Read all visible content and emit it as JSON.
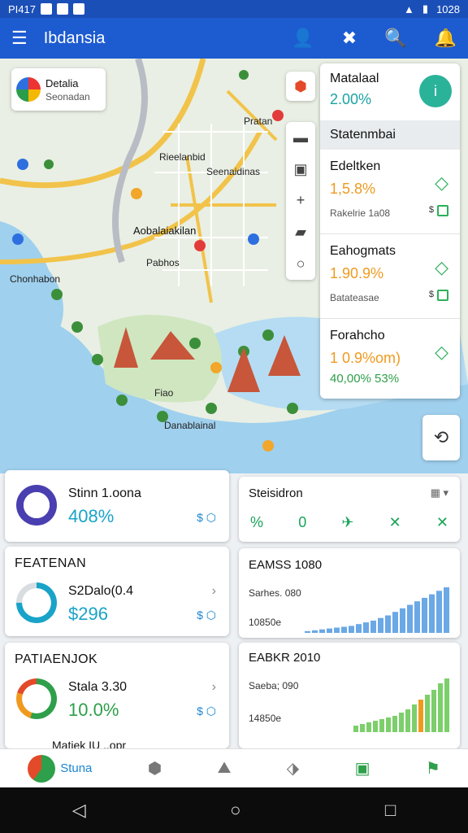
{
  "status_bar": {
    "time": "PI417",
    "right_time": "1028"
  },
  "app_bar": {
    "title": "Ibdansia"
  },
  "map": {
    "place_card": {
      "title": "Detalia",
      "subtitle": "Seonadan"
    },
    "labels": [
      "Pratan",
      "Rieelanbid",
      "Seenaidinas",
      "Aobalaiakilan",
      "Chonhabon",
      "Pabhos",
      "Fiao",
      "Danablainal"
    ]
  },
  "side_panel": {
    "title": "Matalaal",
    "value": "2.00%",
    "section_header": "Statenmbai",
    "items": [
      {
        "name": "Edeltken",
        "pct": "1,5.8%",
        "sub": "Rakelrie 1a08"
      },
      {
        "name": "Eahogmats",
        "pct": "1.90.9%",
        "sub": "Batateasae"
      },
      {
        "name": "Forahcho",
        "pct": "1 0.9%om)",
        "sub": "40,00% 53%"
      }
    ]
  },
  "cards": {
    "kpi1": {
      "label": "Stinn 1.oona",
      "value": "408%"
    },
    "kpi2": {
      "header": "FEATENAN",
      "label": "S2Dalo(0.4",
      "value": "$296"
    },
    "kpi3": {
      "header": "PATIAENJOK",
      "label": "Stala 3.30",
      "value": "10.0%"
    },
    "kpi4": {
      "label": "Matiek IU ..opr",
      "value": "Stuna"
    },
    "stat": {
      "title": "Steisidron"
    },
    "chart1": {
      "title": "EAMSS 1080",
      "sub1": "Sarhes. 080",
      "sub2": "10850e"
    },
    "chart2": {
      "title": "EABKR 2010",
      "sub1": "Saeba; 090",
      "sub2": "14850e"
    }
  },
  "chart_data": [
    {
      "type": "bar",
      "title": "EAMSS 1080",
      "values": [
        2,
        3,
        4,
        5,
        6,
        7,
        8,
        10,
        12,
        14,
        17,
        20,
        24,
        28,
        32,
        36,
        40,
        44,
        48,
        52
      ]
    },
    {
      "type": "bar",
      "title": "EABKR 2010",
      "values": [
        8,
        10,
        12,
        14,
        16,
        18,
        20,
        24,
        28,
        34,
        40,
        46,
        52,
        60,
        66
      ]
    }
  ],
  "colors": {
    "primary": "#1d5bd0",
    "teal": "#1aa3a3",
    "green": "#2e9f4a",
    "orange": "#ef9a1f",
    "bar_blue": "#6aa8e6",
    "bar_green": "#7ccf6a"
  }
}
